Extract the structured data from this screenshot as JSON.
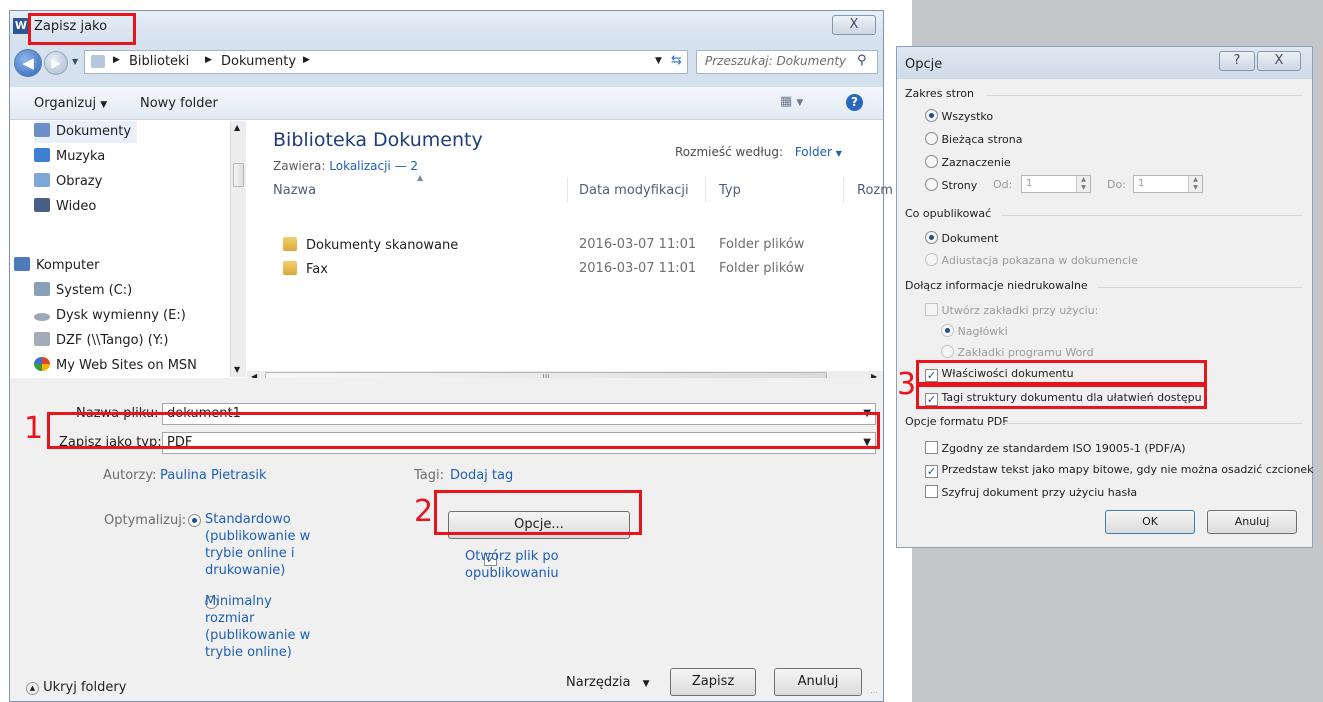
{
  "save_dialog": {
    "app_icon": "W",
    "title": "Zapisz jako",
    "close_glyph": "X",
    "breadcrumb": [
      "Biblioteki",
      "Dokumenty"
    ],
    "search_placeholder": "Przeszukaj: Dokumenty",
    "toolbar": {
      "organize": "Organizuj",
      "new_folder": "Nowy folder"
    },
    "nav_items": [
      {
        "label": "Dokumenty",
        "icon": "documents-icon",
        "color": "#6d8fc9"
      },
      {
        "label": "Muzyka",
        "icon": "music-icon",
        "color": "#3f7fd1"
      },
      {
        "label": "Obrazy",
        "icon": "pictures-icon",
        "color": "#7fa6d8"
      },
      {
        "label": "Wideo",
        "icon": "video-icon",
        "color": "#4a5f86"
      },
      {
        "label": "Komputer",
        "icon": "computer-icon",
        "color": "#4f7bb8"
      },
      {
        "label": "System (C:)",
        "icon": "drive-icon",
        "color": "#8aa0b8"
      },
      {
        "label": "Dysk wymienny (E:)",
        "icon": "removable-drive-icon",
        "color": "#9ca8b5"
      },
      {
        "label": "DZF (\\\\Tango) (Y:)",
        "icon": "network-drive-icon",
        "color": "#a1acb8"
      },
      {
        "label": "My Web Sites on MSN",
        "icon": "msn-icon",
        "color": "#e0452b"
      }
    ],
    "library": {
      "title": "Biblioteka Dokumenty",
      "contains_label": "Zawiera:",
      "contains_link": "Lokalizacji — 2",
      "arrange_label": "Rozmieść według:",
      "arrange_value": "Folder"
    },
    "columns": [
      "Nazwa",
      "Data modyfikacji",
      "Typ",
      "Rozm"
    ],
    "files": [
      {
        "name": "Dokumenty skanowane",
        "date": "2016-03-07 11:01",
        "type": "Folder plików"
      },
      {
        "name": "Fax",
        "date": "2016-03-07 11:01",
        "type": "Folder plików"
      }
    ],
    "hscroll_grip": "III",
    "filename_label": "Nazwa pliku:",
    "filename_value": "dokument1",
    "filetype_label": "Zapisz jako typ:",
    "filetype_value": "PDF",
    "authors_label": "Autorzy:",
    "authors_value": "Paulina Pietrasik",
    "tags_label": "Tagi:",
    "tags_value": "Dodaj tag",
    "optimize_label": "Optymalizuj:",
    "optimize_standard": "Standardowo (publikowanie w trybie online i drukowanie)",
    "optimize_minimal": "Minimalny rozmiar (publikowanie w trybie online)",
    "options_button": "Opcje...",
    "open_after": "Otwórz plik po opublikowaniu",
    "hide_folders": "Ukryj foldery",
    "tools": "Narzędzia",
    "save": "Zapisz",
    "cancel": "Anuluj"
  },
  "options_dialog": {
    "title": "Opcje",
    "help_glyph": "?",
    "close_glyph": "X",
    "page_range_title": "Zakres stron",
    "page_range": [
      "Wszystko",
      "Bieżąca strona",
      "Zaznaczenie",
      "Strony"
    ],
    "from_label": "Od:",
    "from_value": "1",
    "to_label": "Do:",
    "to_value": "1",
    "publish_title": "Co opublikować",
    "publish": [
      "Dokument",
      "Adiustacja pokazana w dokumencie"
    ],
    "nonprint_title": "Dołącz informacje niedrukowalne",
    "bookmarks": "Utwórz zakładki przy użyciu:",
    "bookmarks_sub": [
      "Nagłówki",
      "Zakładki programu Word"
    ],
    "doc_properties": "Właściwości dokumentu",
    "struct_tags": "Tagi struktury dokumentu dla ułatwień dostępu",
    "pdf_title": "Opcje formatu PDF",
    "pdf_options": [
      "Zgodny ze standardem ISO 19005-1 (PDF/A)",
      "Przedstaw tekst jako mapy bitowe, gdy nie można osadzić czcionek",
      "Szyfruj dokument przy użyciu hasła"
    ],
    "ok": "OK",
    "cancel": "Anuluj"
  },
  "annotations": {
    "n1": "1",
    "n2": "2",
    "n3": "3"
  },
  "colors": {
    "annotation_red": "#e8141c",
    "link_blue": "#1e5fb4"
  }
}
